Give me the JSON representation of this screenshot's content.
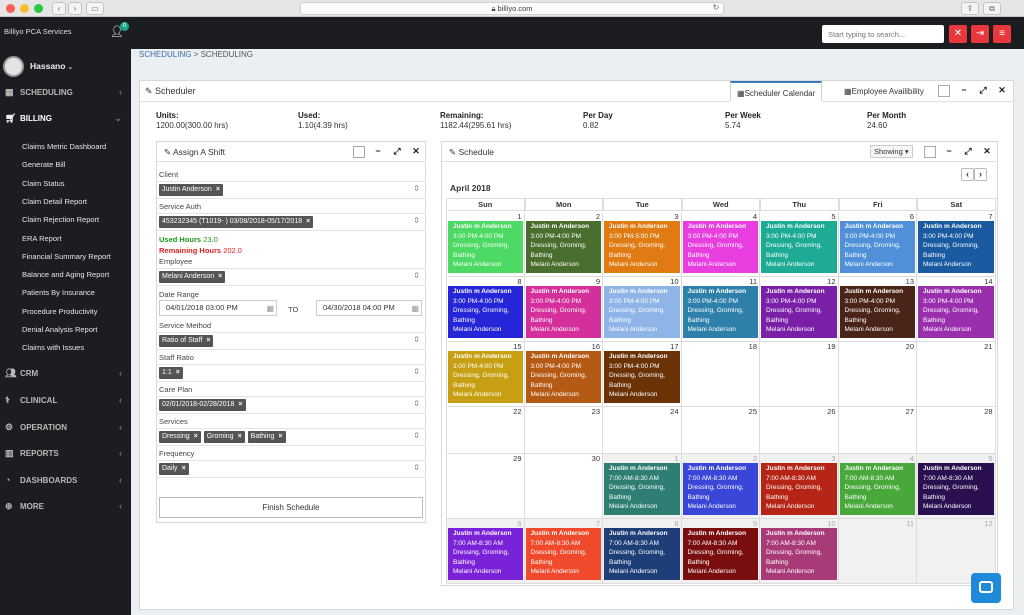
{
  "browser": {
    "url": "billiyo.com"
  },
  "app": {
    "brand": "Billiyo PCA Services",
    "notification_count": "0"
  },
  "header": {
    "search_placeholder": "Start typing to search..."
  },
  "sidebar": {
    "user_name": "Hassano",
    "sections": [
      {
        "label": "SCHEDULING",
        "icon": "calendar-icon"
      },
      {
        "label": "BILLING",
        "icon": "cart-icon"
      },
      {
        "label": "CRM",
        "icon": "users-icon"
      },
      {
        "label": "CLINICAL",
        "icon": "clinical-icon"
      },
      {
        "label": "OPERATION",
        "icon": "gear-icon"
      },
      {
        "label": "REPORTS",
        "icon": "chart-icon"
      },
      {
        "label": "DASHBOARDS",
        "icon": "dashboard-icon"
      },
      {
        "label": "MORE",
        "icon": "plus-icon"
      }
    ],
    "billing_items": [
      "Claims Metric Dashboard",
      "Generate Bill",
      "Claim Status",
      "Claim Detail Report",
      "Claim Rejection Report",
      "ERA Report",
      "Financial Summary Report",
      "Balance and Aging Report",
      "Patients By Insurance",
      "Procedure Productivity",
      "Denial Analysis Report",
      "Claims with Issues"
    ]
  },
  "breadcrumb": {
    "first": "SCHEDULING",
    "separator": " > ",
    "second": "SCHEDULING"
  },
  "scheduler": {
    "title": "Scheduler",
    "tabs": [
      "Scheduler Calendar",
      "Employee Availibility"
    ],
    "stats": [
      {
        "label": "Units:",
        "value": "1200.00(300.00 hrs)"
      },
      {
        "label": "Used:",
        "value": "1.10(4.39 hrs)"
      },
      {
        "label": "Remaining:",
        "value": "1182.44(295.61 hrs)"
      },
      {
        "label": "Per Day",
        "value": "0.82"
      },
      {
        "label": "Per Week",
        "value": "5.74"
      },
      {
        "label": "Per Month",
        "value": "24.60"
      }
    ]
  },
  "assign": {
    "title": "Assign A Shift",
    "client_label": "Client",
    "client": "Justin Anderson",
    "service_auth_label": "Service Auth",
    "service_auth": "453232345 (T1019- ) 03/08/2018-05/17/2018",
    "used_hours_label": "Used Hours",
    "used_hours": "23.0",
    "remaining_hours_label": "Remaining Hours",
    "remaining_hours": "202.0",
    "employee_label": "Employee",
    "employee": "Melani Anderson",
    "date_range_label": "Date Range",
    "date_from": "04/01/2018 03:00 PM",
    "to_label": "TO",
    "date_to": "04/30/2018 04:00 PM",
    "service_method_label": "Service Method",
    "service_method": "Ratio of Staff",
    "staff_ratio_label": "Staff Ratio",
    "staff_ratio": "1:1",
    "care_plan_label": "Care Plan",
    "care_plan": "02/01/2018-02/28/2018",
    "services_label": "Services",
    "services": [
      "Dressing",
      "Groming",
      "Bathing"
    ],
    "frequency_label": "Frequency",
    "frequency": "Daily",
    "finish_label": "Finish Schedule"
  },
  "schedule": {
    "title": "Schedule",
    "showing_label": "Showing",
    "month_label": "April 2018",
    "day_headers": [
      "Sun",
      "Mon",
      "Tue",
      "Wed",
      "Thu",
      "Fri",
      "Sat"
    ],
    "weeks": [
      [
        "1",
        "2",
        "3",
        "4",
        "5",
        "6",
        "7"
      ],
      [
        "8",
        "9",
        "10",
        "11",
        "12",
        "13",
        "14"
      ],
      [
        "15",
        "16",
        "17",
        "18",
        "19",
        "20",
        "21"
      ],
      [
        "22",
        "23",
        "24",
        "25",
        "26",
        "27",
        "28"
      ],
      [
        "29",
        "30",
        "1",
        "2",
        "3",
        "4",
        "5"
      ],
      [
        "6",
        "7",
        "8",
        "9",
        "10",
        "11",
        "12"
      ]
    ],
    "events": [
      {
        "week": 0,
        "day": 0,
        "name": "Justin m Anderson",
        "time": "3:00 PM-4:00 PM",
        "services": "Dressing, Groming, Bathing",
        "employee": "Melani Anderson",
        "color": "#4cd964"
      },
      {
        "week": 0,
        "day": 1,
        "name": "Justin m Anderson",
        "time": "3:00 PM-4:00 PM",
        "services": "Dressing, Groming, Bathing",
        "employee": "Melani Anderson",
        "color": "#4a6e2e"
      },
      {
        "week": 0,
        "day": 2,
        "name": "Justin m Anderson",
        "time": "3:00 PM-5:00 PM",
        "services": "Dressing, Groming, Bathing",
        "employee": "Melani Anderson",
        "color": "#e07a12"
      },
      {
        "week": 0,
        "day": 3,
        "name": "Justin m Anderson",
        "time": "3:00 PM-4:00 PM",
        "services": "Dressing, Groming, Bathing",
        "employee": "Melani Anderson",
        "color": "#e83ee0"
      },
      {
        "week": 0,
        "day": 4,
        "name": "Justin m Anderson",
        "time": "3:00 PM-4:00 PM",
        "services": "Dressing, Groming, Bathing",
        "employee": "Melani Anderson",
        "color": "#1eab96"
      },
      {
        "week": 0,
        "day": 5,
        "name": "Justin m Anderson",
        "time": "3:00 PM-4:00 PM",
        "services": "Dressing, Groming, Bathing",
        "employee": "Melani Anderson",
        "color": "#4f90d8"
      },
      {
        "week": 0,
        "day": 6,
        "name": "Justin m Anderson",
        "time": "3:00 PM-4:00 PM",
        "services": "Dressing, Groming, Bathing",
        "employee": "Melani Anderson",
        "color": "#1a5aa0"
      },
      {
        "week": 1,
        "day": 0,
        "name": "Justin m Anderson",
        "time": "3:00 PM-4:00 PM",
        "services": "Dressing, Groming, Bathing",
        "employee": "Melani Anderson",
        "color": "#2626d8"
      },
      {
        "week": 1,
        "day": 1,
        "name": "Justin m Anderson",
        "time": "3:00 PM-4:00 PM",
        "services": "Dressing, Groming, Bathing",
        "employee": "Melani Anderson",
        "color": "#d42f9a"
      },
      {
        "week": 1,
        "day": 2,
        "name": "Justin m Anderson",
        "time": "3:00 PM-4:00 PM",
        "services": "Dressing, Groming, Bathing",
        "employee": "Melani Anderson",
        "color": "#8fb4e8"
      },
      {
        "week": 1,
        "day": 3,
        "name": "Justin m Anderson",
        "time": "3:00 PM-4:00 PM",
        "services": "Dressing, Groming, Bathing",
        "employee": "Melani Anderson",
        "color": "#2e80ab"
      },
      {
        "week": 1,
        "day": 4,
        "name": "Justin m Anderson",
        "time": "3:00 PM-4:00 PM",
        "services": "Dressing, Groming, Bathing",
        "employee": "Melani Anderson",
        "color": "#7a1fa8"
      },
      {
        "week": 1,
        "day": 5,
        "name": "Justin m Anderson",
        "time": "3:00 PM-4:00 PM",
        "services": "Dressing, Groming, Bathing",
        "employee": "Melani Anderson",
        "color": "#4a2418"
      },
      {
        "week": 1,
        "day": 6,
        "name": "Justin m Anderson",
        "time": "3:00 PM-4:00 PM",
        "services": "Dressing, Groming, Bathing",
        "employee": "Melani Anderson",
        "color": "#9a2fae"
      },
      {
        "week": 2,
        "day": 0,
        "name": "Justin m Anderson",
        "time": "3:00 PM-4:00 PM",
        "services": "Dressing, Groming, Bathing",
        "employee": "Melani Anderson",
        "color": "#c6a012"
      },
      {
        "week": 2,
        "day": 1,
        "name": "Justin m Anderson",
        "time": "3:00 PM-4:00 PM",
        "services": "Dressing, Groming, Bathing",
        "employee": "Melani Anderson",
        "color": "#b55a14"
      },
      {
        "week": 2,
        "day": 2,
        "name": "Justin m Anderson",
        "time": "3:00 PM-4:00 PM",
        "services": "Dressing, Groming, Bathing",
        "employee": "Melani Anderson",
        "color": "#6b3206"
      },
      {
        "week": 4,
        "day": 2,
        "name": "Justin m Anderson",
        "time": "7:00 AM-8:30 AM",
        "services": "Dressing, Groming, Bathing",
        "employee": "Melani Anderson",
        "color": "#2e7e74"
      },
      {
        "week": 4,
        "day": 3,
        "name": "Justin m Anderson",
        "time": "7:00 AM-8:30 AM",
        "services": "Dressing, Groming, Bathing",
        "employee": "Melani Anderson",
        "color": "#3a46d8"
      },
      {
        "week": 4,
        "day": 4,
        "name": "Justin m Anderson",
        "time": "7:00 AM-8:30 AM",
        "services": "Dressing, Groming, Bathing",
        "employee": "Melani Anderson",
        "color": "#b52414"
      },
      {
        "week": 4,
        "day": 5,
        "name": "Justin m Anderson",
        "time": "7:00 AM-8:30 AM",
        "services": "Dressing, Groming, Bathing",
        "employee": "Melani Anderson",
        "color": "#48a83a"
      },
      {
        "week": 4,
        "day": 6,
        "name": "Justin m Anderson",
        "time": "7:00 AM-8:30 AM",
        "services": "Dressing, Groming, Bathing",
        "employee": "Melani Anderson",
        "color": "#2a1050"
      },
      {
        "week": 5,
        "day": 0,
        "name": "Justin m Anderson",
        "time": "7:00 AM-8:30 AM",
        "services": "Dressing, Groming, Bathing",
        "employee": "Melani Anderson",
        "color": "#7a22d8"
      },
      {
        "week": 5,
        "day": 1,
        "name": "Justin m Anderson",
        "time": "7:00 AM-8:30 AM",
        "services": "Dressing, Groming, Bathing",
        "employee": "Melani Anderson",
        "color": "#f04a2c"
      },
      {
        "week": 5,
        "day": 2,
        "name": "Justin m Anderson",
        "time": "7:00 AM-8:30 AM",
        "services": "Dressing, Groming, Bathing",
        "employee": "Melani Anderson",
        "color": "#1e3e78"
      },
      {
        "week": 5,
        "day": 3,
        "name": "Justin m Anderson",
        "time": "7:00 AM-8:30 AM",
        "services": "Dressing, Groming, Bathing",
        "employee": "Melani Anderson",
        "color": "#7a0e0e"
      },
      {
        "week": 5,
        "day": 4,
        "name": "Justin m Anderson",
        "time": "7:00 AM-8:30 AM",
        "services": "Dressing, Groming, Bathing",
        "employee": "Melani Anderson",
        "color": "#a83a78"
      }
    ]
  }
}
